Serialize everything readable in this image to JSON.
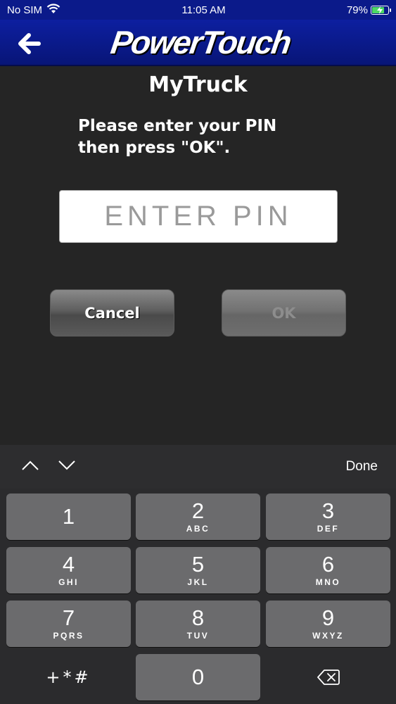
{
  "status_bar": {
    "carrier": "No SIM",
    "time": "11:05 AM",
    "battery": "79%",
    "battery_level": 0.79
  },
  "header": {
    "logo": "PowerTouch",
    "brand_color": "#0b1a8a"
  },
  "page": {
    "title": "MyTruck",
    "instructions_line1": "Please enter your PIN",
    "instructions_line2": "then press \"OK\"."
  },
  "pin_field": {
    "placeholder": "ENTER PIN",
    "value": ""
  },
  "buttons": {
    "cancel": "Cancel",
    "ok": "OK"
  },
  "keyboard": {
    "done": "Done",
    "keys": [
      {
        "digit": "1",
        "letters": ""
      },
      {
        "digit": "2",
        "letters": "ABC"
      },
      {
        "digit": "3",
        "letters": "DEF"
      },
      {
        "digit": "4",
        "letters": "GHI"
      },
      {
        "digit": "5",
        "letters": "JKL"
      },
      {
        "digit": "6",
        "letters": "MNO"
      },
      {
        "digit": "7",
        "letters": "PQRS"
      },
      {
        "digit": "8",
        "letters": "TUV"
      },
      {
        "digit": "9",
        "letters": "WXYZ"
      }
    ],
    "symbols": "+*#",
    "zero": "0"
  }
}
